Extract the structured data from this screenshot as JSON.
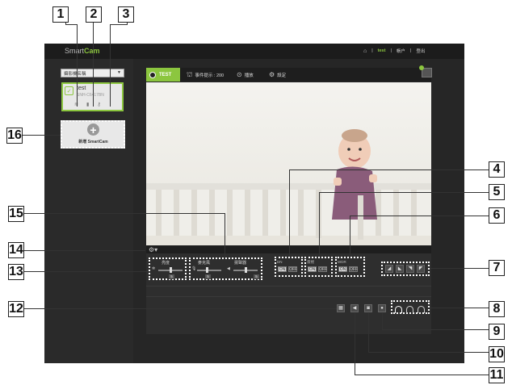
{
  "header": {
    "logo_main": "Smart",
    "logo_accent": "Cam",
    "home_icon": "home-icon",
    "user": "test",
    "account": "帳户",
    "logout": "登出",
    "sep": "|"
  },
  "sidebar": {
    "sort_select": "攝影機名稱",
    "camera": {
      "name": "test",
      "id": "SNH-C6417BN",
      "icons": [
        "wifi-icon",
        "trash-icon",
        "key-icon"
      ]
    },
    "add_label": "新增 SmartCam"
  },
  "tabs": {
    "live": "TEST",
    "events": "事件提示 : 200",
    "playback": "播放",
    "settings": "設定"
  },
  "controls": {
    "brightness_label": "亮度",
    "brightness_value": "5",
    "brightness_level": 0.5,
    "mic_label": "麥克風",
    "mic_value": "5",
    "mic_level": 0.5,
    "speaker_label": "揚聲器",
    "speaker_value": "5",
    "speaker_level": 0.5,
    "toggle1_label": "DN",
    "toggle2_label": "夜視",
    "toggle3_label": "WDR",
    "on": "ON",
    "off": "OFF"
  },
  "callouts": [
    "1",
    "2",
    "3",
    "4",
    "5",
    "6",
    "7",
    "8",
    "9",
    "10",
    "11",
    "12",
    "13",
    "14",
    "15",
    "16"
  ],
  "colors": {
    "accent": "#8cc63f",
    "frame": "#2b2b2b",
    "topbar": "#1c1c1c"
  }
}
